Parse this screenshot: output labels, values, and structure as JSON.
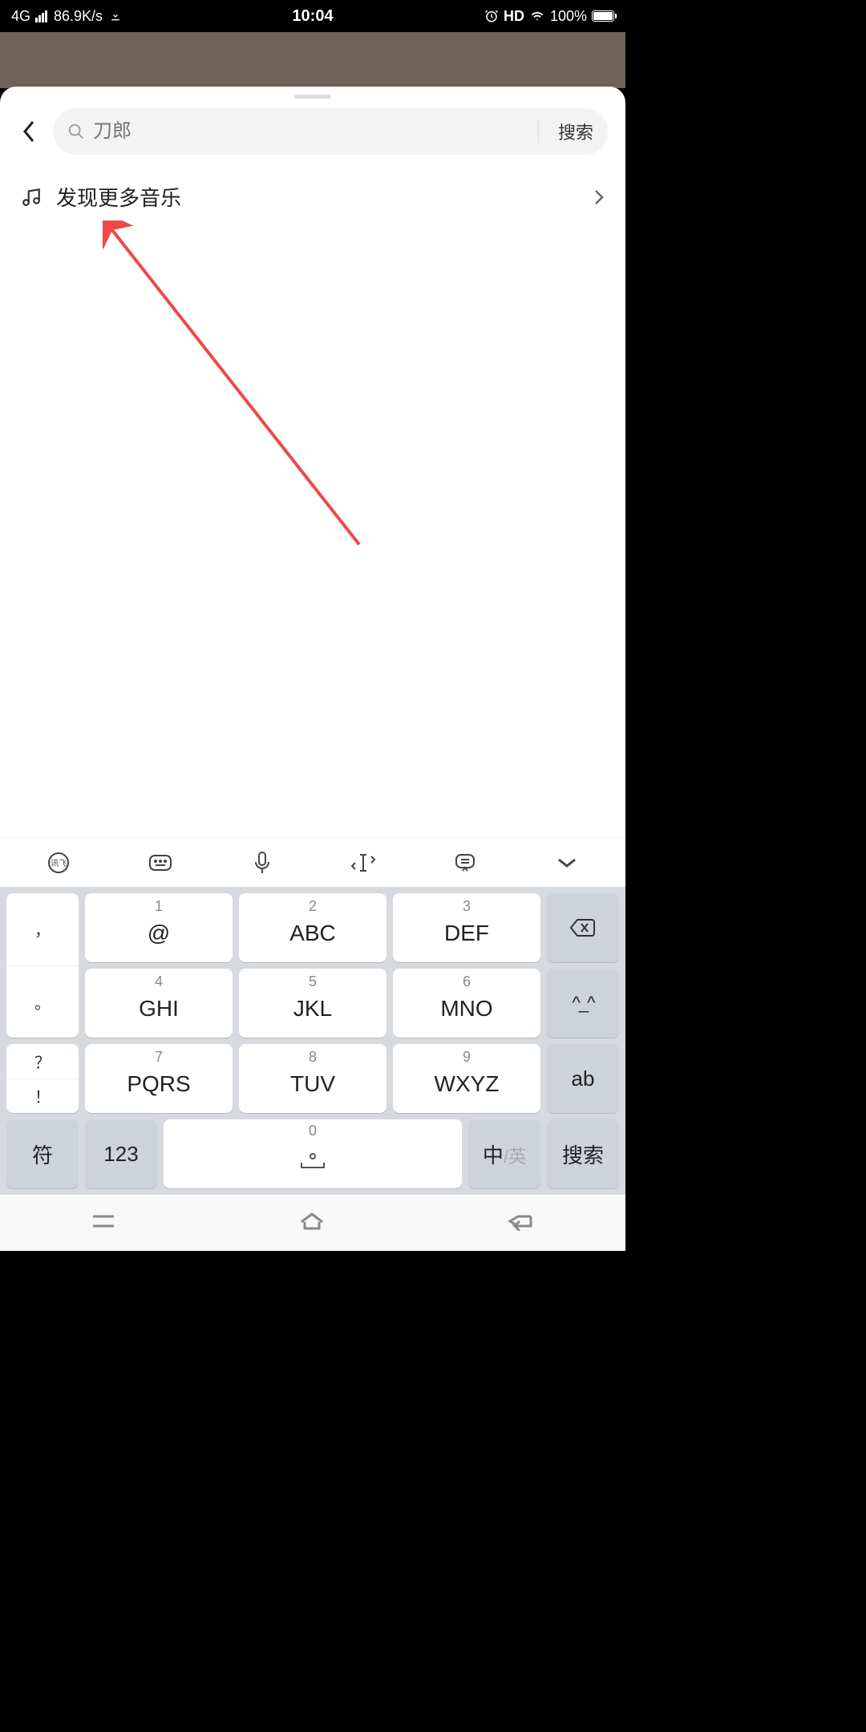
{
  "status": {
    "network": "4G",
    "speed": "86.9K/s",
    "time": "10:04",
    "hd": "HD",
    "battery_pct": "100%"
  },
  "search": {
    "placeholder": "刀郎",
    "button": "搜索"
  },
  "discover": {
    "label": "发现更多音乐"
  },
  "keyboard": {
    "toolbar": [
      "ifly",
      "keyboard",
      "mic",
      "cursor",
      "message",
      "collapse"
    ],
    "keys": [
      {
        "num": "1",
        "main": "@"
      },
      {
        "num": "2",
        "main": "ABC"
      },
      {
        "num": "3",
        "main": "DEF"
      },
      {
        "num": "4",
        "main": "GHI"
      },
      {
        "num": "5",
        "main": "JKL"
      },
      {
        "num": "6",
        "main": "MNO"
      },
      {
        "num": "7",
        "main": "PQRS"
      },
      {
        "num": "8",
        "main": "TUV"
      },
      {
        "num": "9",
        "main": "WXYZ"
      }
    ],
    "side_left": [
      "，",
      "。",
      "？",
      "！"
    ],
    "backspace": "⌫",
    "emoji": "^_^",
    "ab": "ab",
    "symbol": "符",
    "num_mode": "123",
    "space_num": "0",
    "lang_primary": "中",
    "lang_sep": "/",
    "lang_secondary": "英",
    "enter": "搜索"
  }
}
